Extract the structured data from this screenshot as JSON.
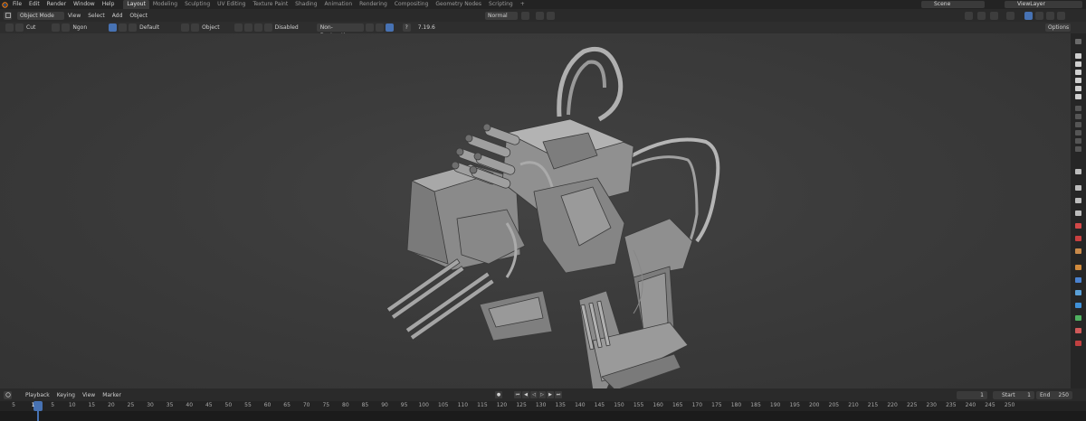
{
  "topbar": {
    "menus": [
      "File",
      "Edit",
      "Render",
      "Window",
      "Help"
    ],
    "workspaces": [
      "Layout",
      "Modeling",
      "Sculpting",
      "UV Editing",
      "Texture Paint",
      "Shading",
      "Animation",
      "Rendering",
      "Compositing",
      "Geometry Nodes",
      "Scripting"
    ],
    "active_workspace": "Layout",
    "add_tab": "+",
    "scene": "Scene",
    "view_layer": "ViewLayer"
  },
  "viewport_header": {
    "mode": "Object Mode",
    "menus": [
      "View",
      "Select",
      "Add",
      "Object"
    ],
    "orientation": "Normal"
  },
  "tool_settings": {
    "tool": "Cut",
    "ngon": "Ngon",
    "material": "Default",
    "object": "Object",
    "snapping": "Disabled",
    "mode": "Non-Destructive",
    "version": "7.19.6",
    "options": "Options"
  },
  "timeline": {
    "menus": [
      "Playback",
      "Keying",
      "View",
      "Marker"
    ],
    "current_frame": "1",
    "start_label": "Start",
    "start": "1",
    "end_label": "End",
    "end": "250",
    "ticks": [
      "5",
      "1",
      "5",
      "10",
      "15",
      "20",
      "25",
      "30",
      "35",
      "40",
      "45",
      "50",
      "55",
      "60",
      "65",
      "70",
      "75",
      "80",
      "85",
      "90",
      "95",
      "100",
      "105",
      "110",
      "115",
      "120",
      "125",
      "130",
      "135",
      "140",
      "145",
      "150",
      "155",
      "160",
      "165",
      "170",
      "175",
      "180",
      "185",
      "190",
      "195",
      "200",
      "205",
      "210",
      "215",
      "220",
      "225",
      "230",
      "235",
      "240",
      "245",
      "250"
    ]
  },
  "colors": {
    "accent": "#4772b3",
    "viewport": "#3d3d3d",
    "model": "#8c8c8c"
  }
}
